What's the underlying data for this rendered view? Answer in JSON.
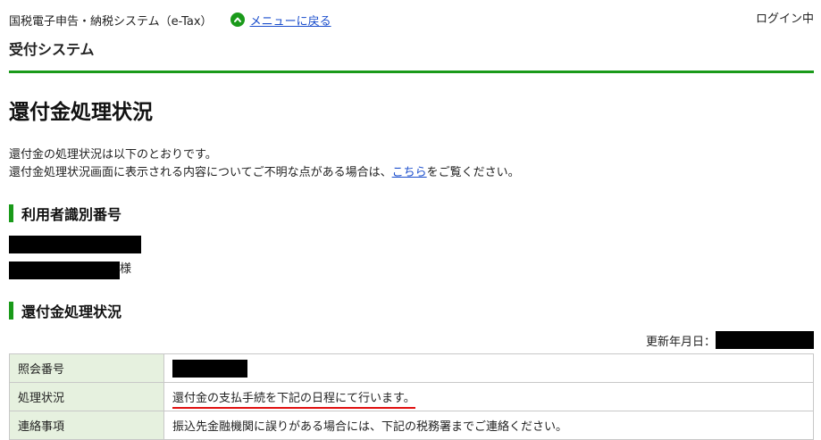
{
  "header": {
    "system_name": "国税電子申告・納税システム（e-Tax）",
    "menu_link": "メニューに戻る",
    "login_status": "ログイン中",
    "subsystem": "受付システム"
  },
  "page": {
    "title": "還付金処理状況",
    "intro_line1": "還付金の処理状況は以下のとおりです。",
    "intro_line2_before": "還付金処理状況画面に表示される内容についてご不明な点がある場合は、",
    "intro_link": "こちら",
    "intro_line2_after": "をご覧ください。"
  },
  "user_section": {
    "heading": "利用者識別番号",
    "honorific": "様"
  },
  "status_section": {
    "heading": "還付金処理状況",
    "updated_label": "更新年月日：",
    "rows": [
      {
        "label": "照会番号",
        "value": ""
      },
      {
        "label": "処理状況",
        "value": "還付金の支払手続を下記の日程にて行います。"
      },
      {
        "label": "連絡事項",
        "value": "振込先金融機関に誤りがある場合には、下記の税務署までご連絡ください。"
      }
    ]
  },
  "colors": {
    "accent_green": "#1a9a1a",
    "link_blue": "#1a4dcc",
    "label_bg": "#e6f1df",
    "highlight_red": "#e01010"
  }
}
